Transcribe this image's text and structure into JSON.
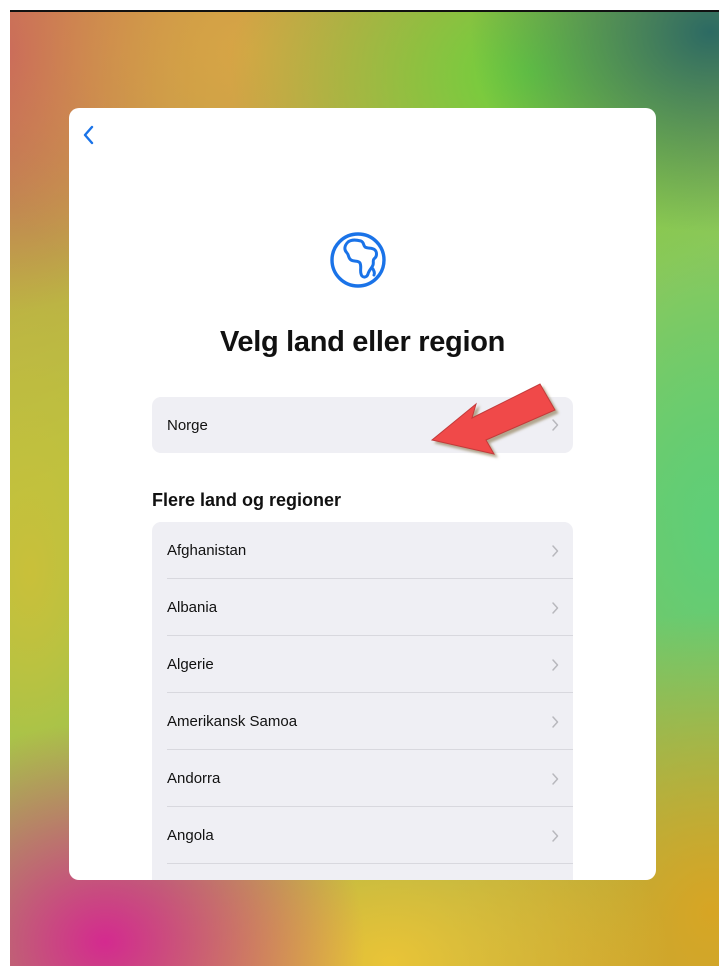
{
  "sheet": {
    "title": "Velg land eller region",
    "selected_region": {
      "label": "Norge"
    },
    "more_section_heading": "Flere land og regioner",
    "countries": [
      {
        "label": "Afghanistan"
      },
      {
        "label": "Albania"
      },
      {
        "label": "Algerie"
      },
      {
        "label": "Amerikansk Samoa"
      },
      {
        "label": "Andorra"
      },
      {
        "label": "Angola"
      }
    ]
  },
  "icons": {
    "back": "chevron-left-icon",
    "globe": "globe-icon",
    "row_chevron": "chevron-right-icon"
  },
  "colors": {
    "accent": "#1a73e8",
    "row_background": "#efeff4",
    "annotation_arrow": "#ef4444"
  }
}
